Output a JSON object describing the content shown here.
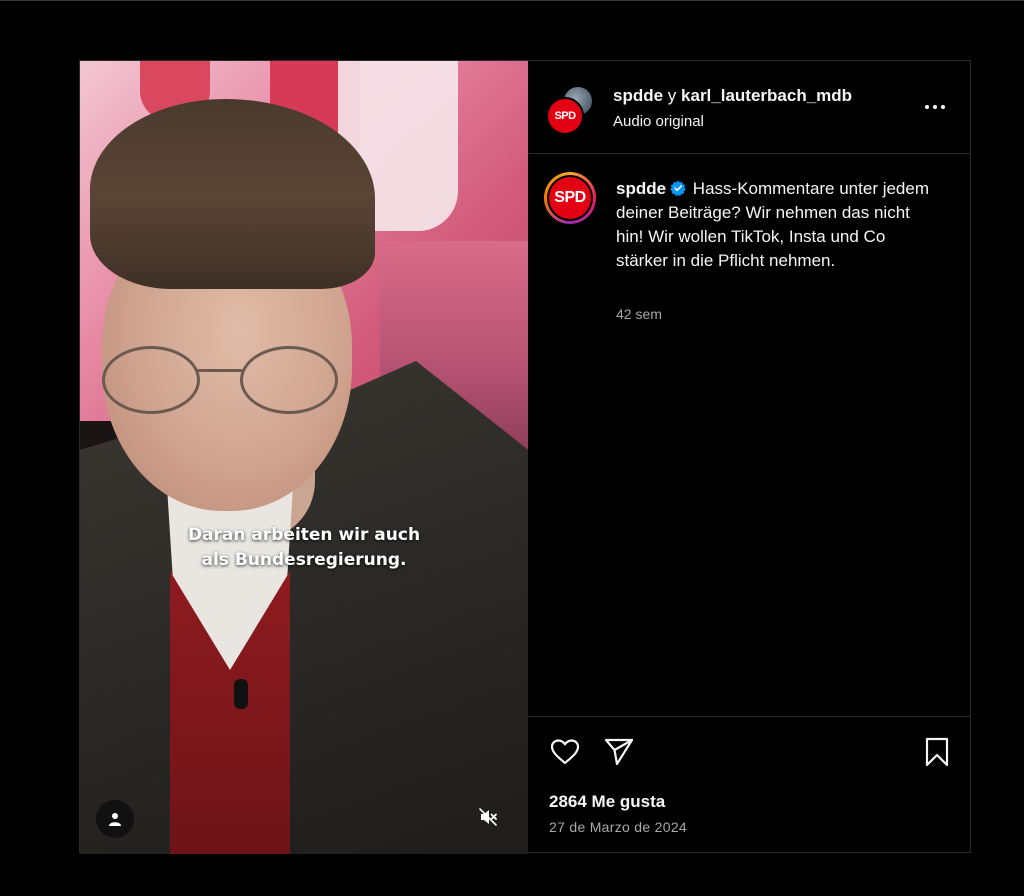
{
  "post": {
    "header": {
      "author": "spdde",
      "connector": "y",
      "coauthor": "karl_lauterbach_mdb",
      "audio_label": "Audio original"
    },
    "video": {
      "subtitle_line1": "Daran arbeiten wir auch",
      "subtitle_line2": "als Bundesregierung."
    },
    "logo_text": "SPD",
    "caption": {
      "user": "spdde",
      "text": "Hass-Kommentare unter jedem deiner Beiträge? Wir nehmen das nicht hin! Wir wollen TikTok, Insta und Co stärker in die Pflicht nehmen.",
      "time": "42 sem"
    },
    "stats": {
      "likes": "2864 Me gusta",
      "date": "27 de Marzo de 2024"
    }
  },
  "icons": {
    "verified": "verified-badge-icon",
    "more": "more-options-icon",
    "like": "heart-icon",
    "share": "paper-plane-icon",
    "save": "bookmark-icon",
    "user_tag": "person-icon",
    "mute": "speaker-muted-icon"
  },
  "colors": {
    "background": "#000000",
    "brand_red": "#e30013",
    "verified_blue": "#0095f6",
    "secondary_text": "#a8a8a8"
  }
}
